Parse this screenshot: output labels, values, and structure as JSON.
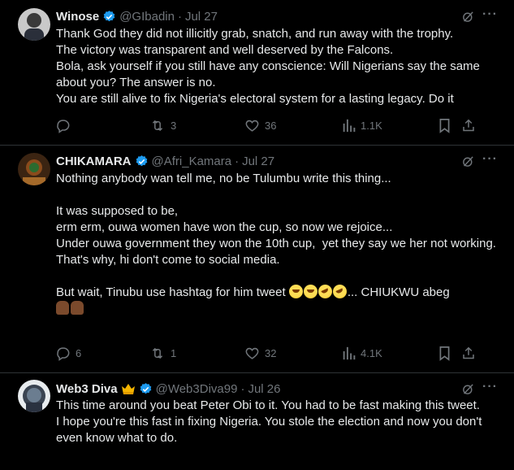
{
  "tweets": [
    {
      "name": "Winose",
      "handle": "@GIbadin",
      "time": "Jul 27",
      "text": "Thank God they did not illicitly grab, snatch, and run away with the trophy.\nThe victory was transparent and well deserved by the Falcons.\nBola, ask yourself if you still have any conscience: Will Nigerians say the same about you? The answer is no.\nYou are still alive to fix Nigeria's electoral system for a lasting legacy. Do it",
      "replies": "",
      "reposts": "3",
      "likes": "36",
      "views": "1.1K"
    },
    {
      "name": "CHIKAMARA",
      "handle": "@Afri_Kamara",
      "time": "Jul 27",
      "text": "Nothing anybody wan tell me, no be Tulumbu write this thing...\n\nIt was supposed to be,\nerm erm, ouwa women have won the cup, so now we rejoice...\nUnder ouwa government they won the 10th cup,  yet they say we her not working.\nThat's why, hi don't come to social media.\n\nBut wait, Tinubu use hashtag for him tweet",
      "text_tail": "... CHIUKWU abeg",
      "replies": "6",
      "reposts": "1",
      "likes": "32",
      "views": "4.1K"
    },
    {
      "name": "Web3 Diva",
      "handle": "@Web3Diva99",
      "time": "Jul 26",
      "text": "This time around you beat Peter Obi to it. You had to be fast making this tweet.\nI hope you're this fast in fixing Nigeria. You stole the election and now you don't even know what to do."
    }
  ],
  "separator": "·",
  "more_label": "···",
  "icons": [
    "grok-icon",
    "reply-icon",
    "repost-icon",
    "like-icon",
    "views-icon",
    "bookmark-icon",
    "share-icon",
    "verified-badge-icon",
    "crown-emoji",
    "laughing-emoji",
    "rofl-emoji",
    "hands-emoji"
  ],
  "colors": {
    "background": "#000000",
    "text": "#e7e9ea",
    "muted": "#71767b",
    "verified": "#1d9bf0",
    "divider": "#2f3336"
  }
}
